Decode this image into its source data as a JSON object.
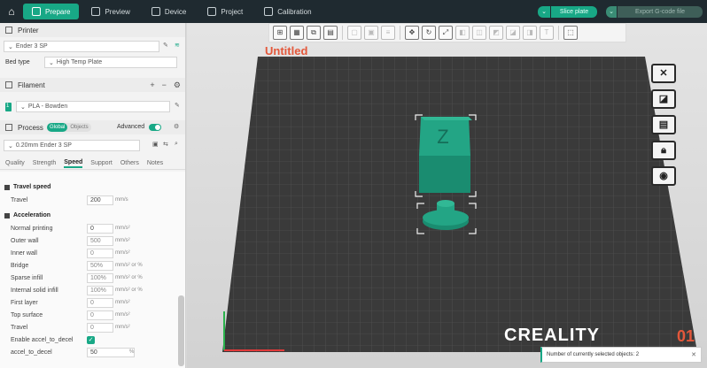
{
  "topbar": {
    "tabs": [
      {
        "label": "Prepare",
        "icon": "prepare-icon",
        "active": true
      },
      {
        "label": "Preview",
        "icon": "preview-icon"
      },
      {
        "label": "Device",
        "icon": "device-icon"
      },
      {
        "label": "Project",
        "icon": "project-icon"
      },
      {
        "label": "Calibration",
        "icon": "calibration-icon"
      }
    ],
    "slice_label": "Slice plate",
    "export_label": "Export G-code file"
  },
  "printer": {
    "section_title": "Printer",
    "name": "Ender 3 SP",
    "bed_type_label": "Bed type",
    "bed_type_value": "High Temp Plate"
  },
  "filament": {
    "section_title": "Filament",
    "slot": "1",
    "name": "PLA - Bowden"
  },
  "process": {
    "section_title": "Process",
    "toggle_global": "Global",
    "toggle_objects": "Objects",
    "advanced_label": "Advanced",
    "preset": "0.20mm Ender 3 SP",
    "tabs": [
      "Quality",
      "Strength",
      "Speed",
      "Support",
      "Others",
      "Notes"
    ],
    "active_tab": "Speed"
  },
  "speed": {
    "travel_group": "Travel speed",
    "travel": {
      "label": "Travel",
      "value": "200",
      "unit": "mm/s"
    },
    "accel_group": "Acceleration",
    "rows": [
      {
        "label": "Normal printing",
        "value": "0",
        "unit": "mm/s²"
      },
      {
        "label": "Outer wall",
        "value": "500",
        "unit": "mm/s²"
      },
      {
        "label": "Inner wall",
        "value": "0",
        "unit": "mm/s²"
      },
      {
        "label": "Bridge",
        "value": "50%",
        "unit": "mm/s² or %"
      },
      {
        "label": "Sparse infill",
        "value": "100%",
        "unit": "mm/s² or %"
      },
      {
        "label": "Internal solid infill",
        "value": "100%",
        "unit": "mm/s² or %"
      },
      {
        "label": "First layer",
        "value": "0",
        "unit": "mm/s²"
      },
      {
        "label": "Top surface",
        "value": "0",
        "unit": "mm/s²"
      },
      {
        "label": "Travel",
        "value": "0",
        "unit": "mm/s²"
      }
    ],
    "enable_accel_label": "Enable accel_to_decel",
    "accel_to_decel_label": "accel_to_decel",
    "accel_to_decel_value": "50",
    "accel_to_decel_unit": "%"
  },
  "viewport": {
    "plate_title": "Untitled",
    "brand": "CREALITY",
    "plate_number": "01",
    "model_letter": "Z",
    "tooltip": "Number of currently selected objects: 2"
  },
  "colors": {
    "accent": "#18a886",
    "plate": "#3a3a3a",
    "model": "#1e9a80",
    "title": "#e4573a"
  }
}
